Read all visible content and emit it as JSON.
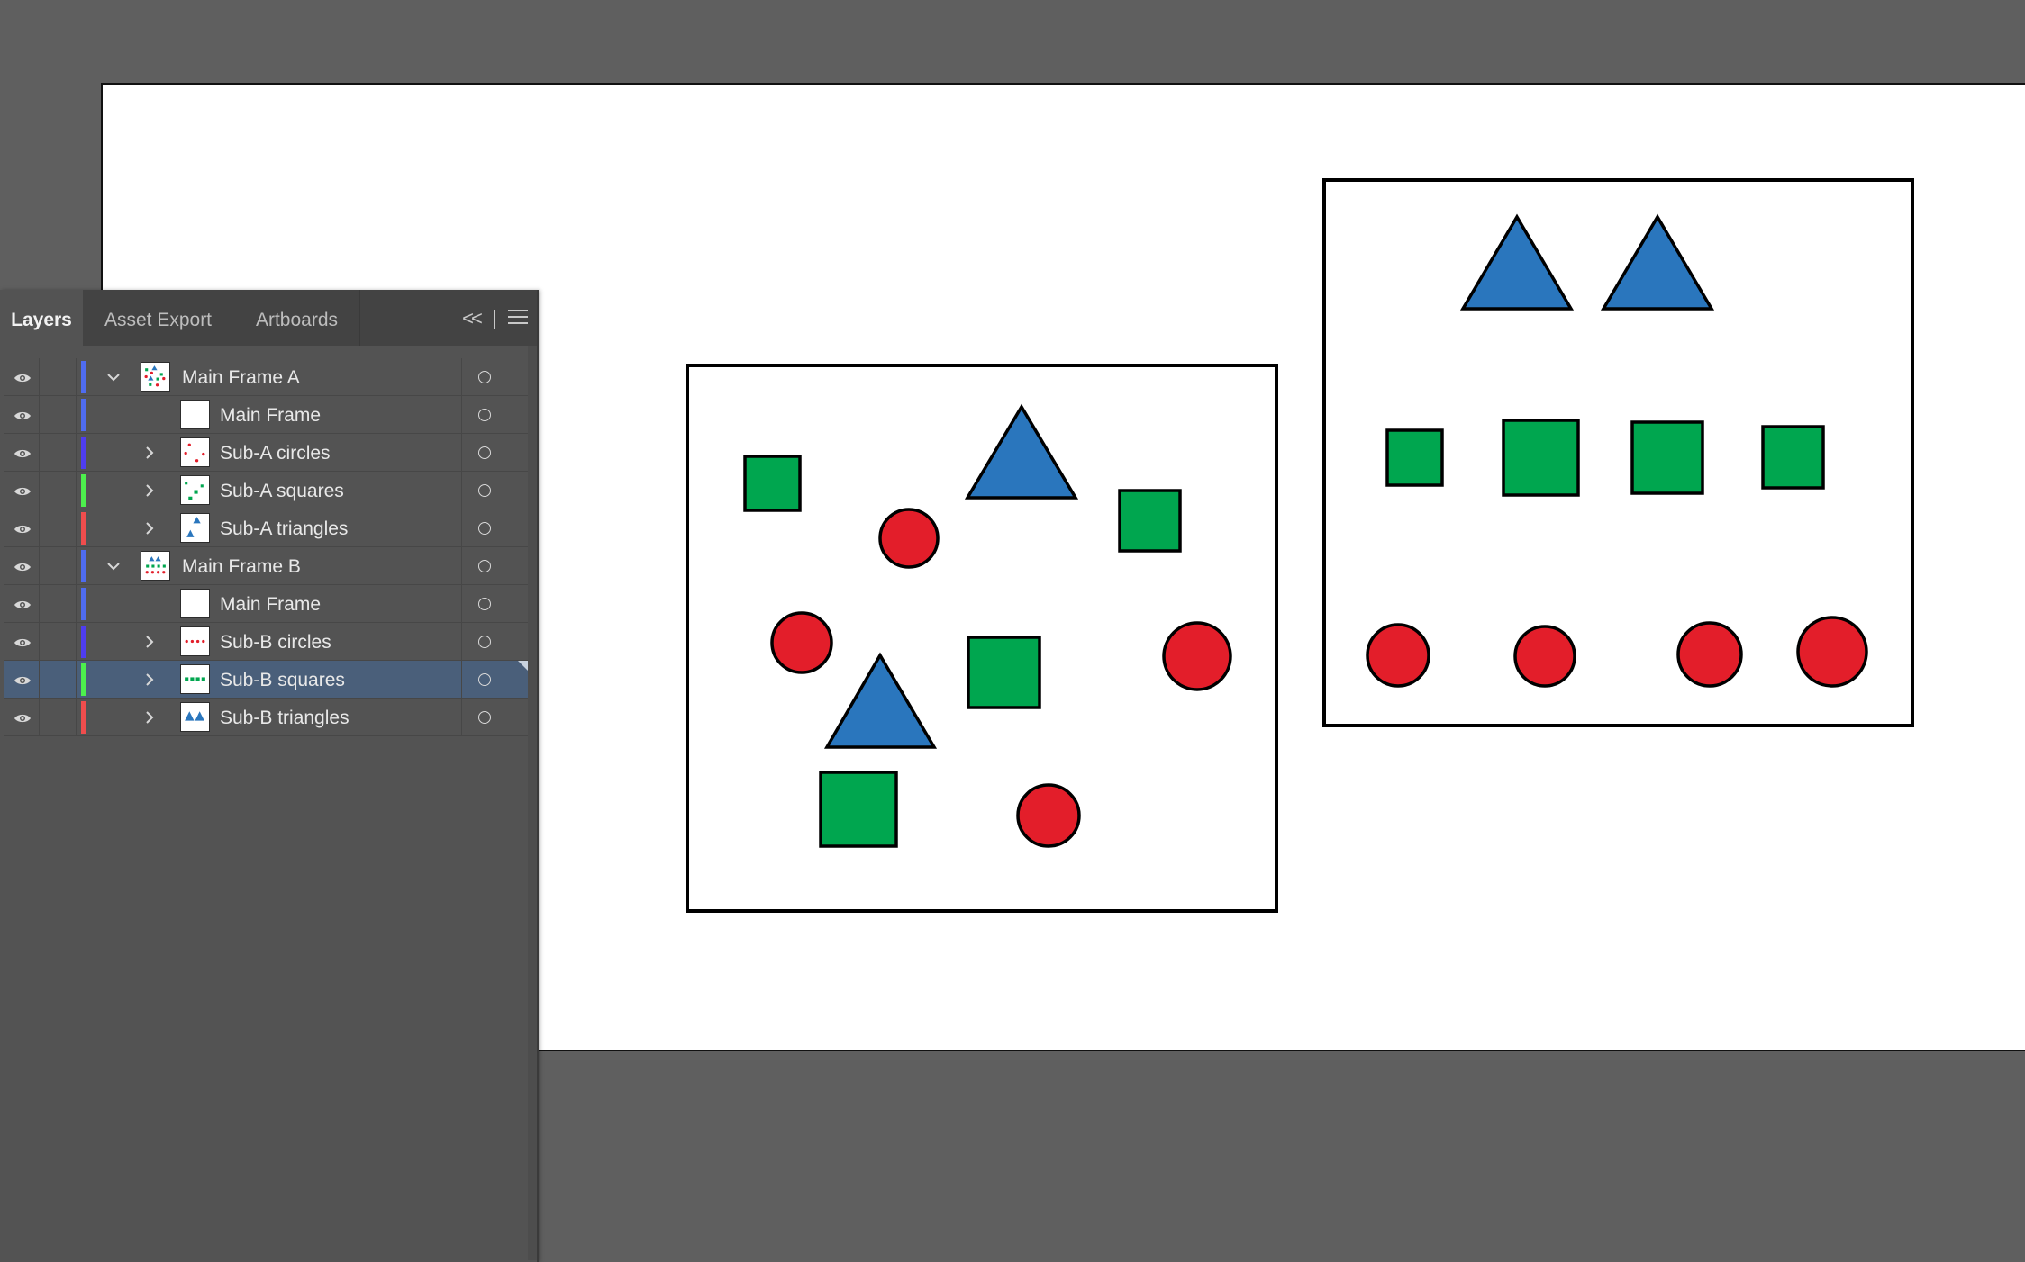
{
  "panel": {
    "tabs": [
      {
        "label": "Layers",
        "active": true
      },
      {
        "label": "Asset Export",
        "active": false
      },
      {
        "label": "Artboards",
        "active": false
      }
    ],
    "collapse_glyph": "<<",
    "menu_icon": "hamburger-menu-icon"
  },
  "layers": [
    {
      "name": "Main Frame A",
      "level": 0,
      "expanded": true,
      "color": "#4f6cf0",
      "thumb": "frame-a-thumb"
    },
    {
      "name": "Main Frame",
      "level": 1,
      "expanded": null,
      "color": "#4f6cf0",
      "thumb": "blank-thumb"
    },
    {
      "name": "Sub-A circles",
      "level": 1,
      "expanded": false,
      "color": "#4f3df0",
      "thumb": "circles-scatter-thumb"
    },
    {
      "name": "Sub-A squares",
      "level": 1,
      "expanded": false,
      "color": "#4df04d",
      "thumb": "squares-scatter-thumb"
    },
    {
      "name": "Sub-A triangles",
      "level": 1,
      "expanded": false,
      "color": "#f04d4d",
      "thumb": "triangles-scatter-thumb"
    },
    {
      "name": "Main Frame B",
      "level": 0,
      "expanded": true,
      "color": "#4f6cf0",
      "thumb": "frame-b-thumb"
    },
    {
      "name": "Main Frame",
      "level": 1,
      "expanded": null,
      "color": "#4f6cf0",
      "thumb": "blank-thumb"
    },
    {
      "name": "Sub-B circles",
      "level": 1,
      "expanded": false,
      "color": "#4f3df0",
      "thumb": "circles-row-thumb"
    },
    {
      "name": "Sub-B squares",
      "level": 1,
      "expanded": false,
      "color": "#4df04d",
      "thumb": "squares-row-thumb",
      "selected": true
    },
    {
      "name": "Sub-B triangles",
      "level": 1,
      "expanded": false,
      "color": "#f04d4d",
      "thumb": "triangles-row-thumb"
    }
  ],
  "colors": {
    "workspace": "#5f5f5f",
    "panel": "#535353",
    "selected_row": "#4a5f7a",
    "shape_green": "#00a64f",
    "shape_red": "#e31e2a",
    "shape_blue": "#2a76bd"
  }
}
